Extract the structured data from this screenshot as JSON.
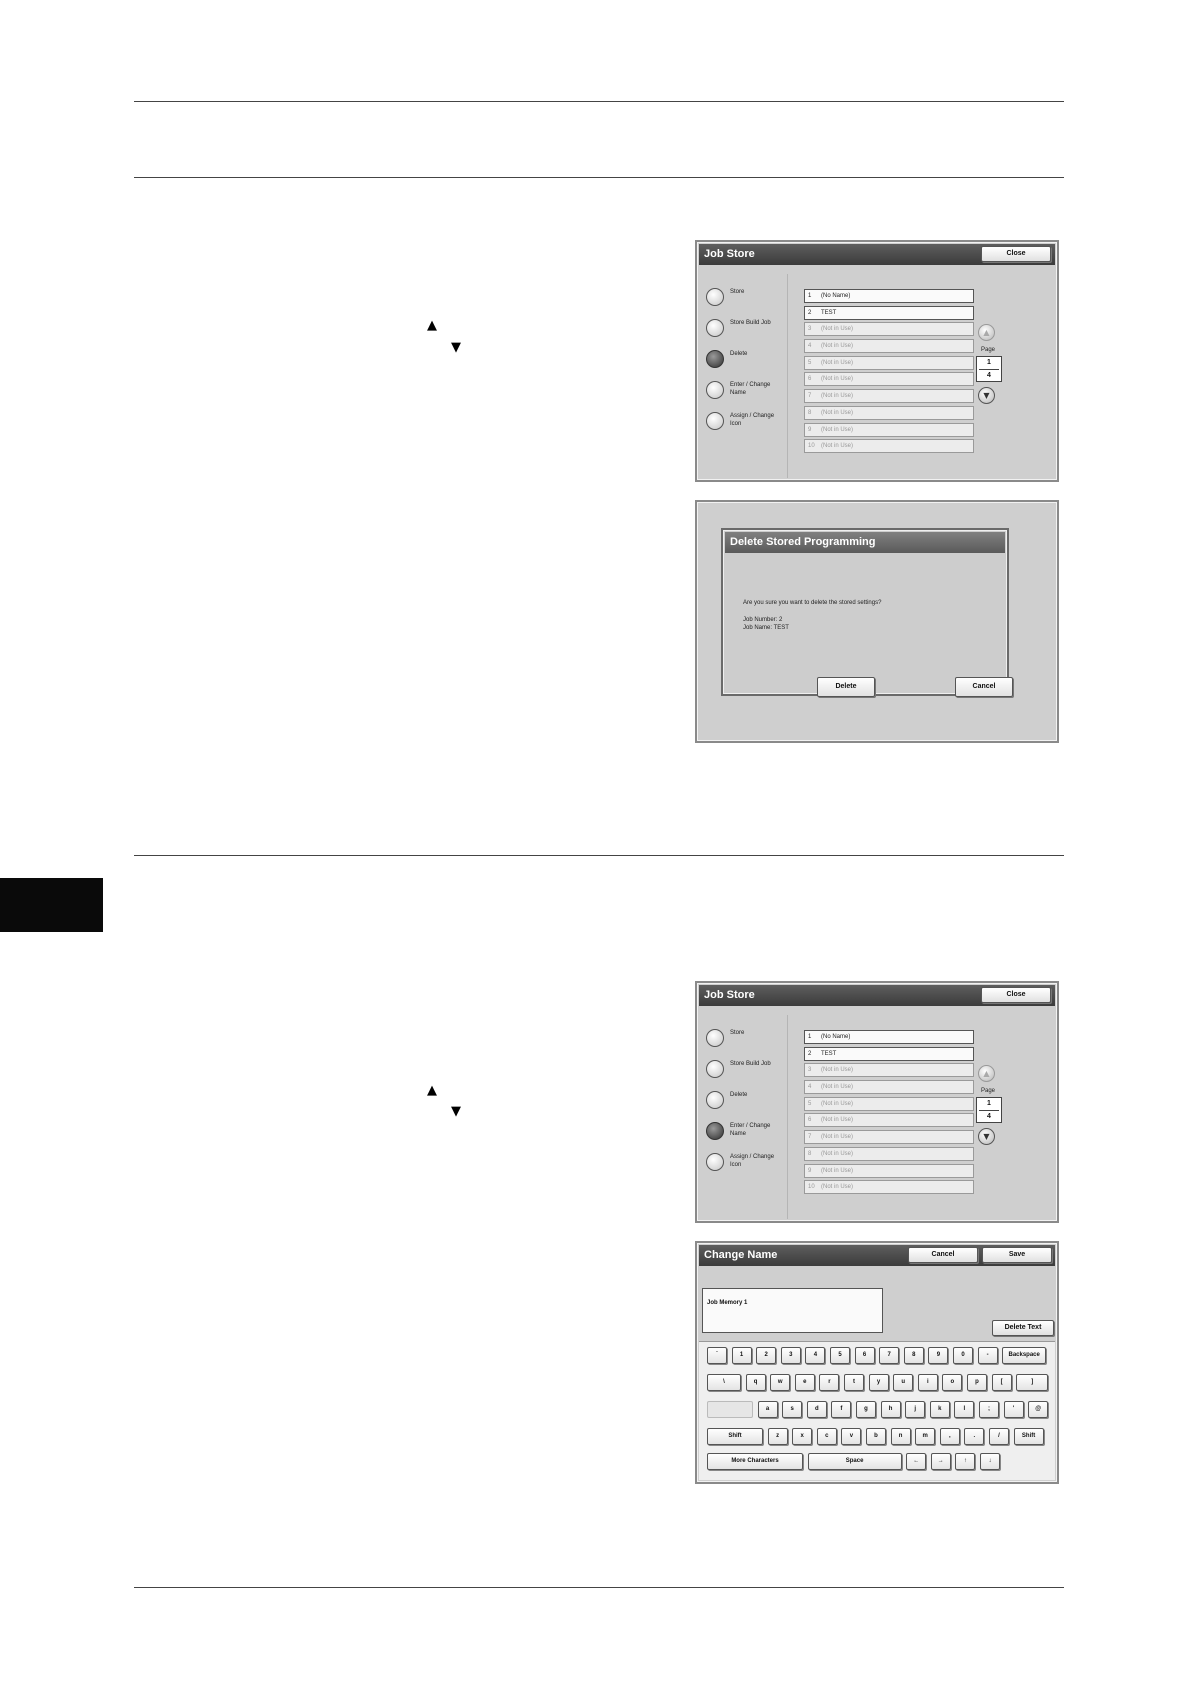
{
  "page": {
    "tab_down_symbol": "▼",
    "tab_up_symbol": "▲"
  },
  "job_store": {
    "title": "Job Store",
    "close_label": "Close",
    "options": [
      {
        "label": "Store"
      },
      {
        "label": "Store Build Job"
      },
      {
        "label": "Delete"
      },
      {
        "label": "Enter / Change Name"
      },
      {
        "label": "Assign / Change Icon"
      }
    ],
    "items": [
      {
        "num": "1",
        "name": "(No Name)",
        "used": true
      },
      {
        "num": "2",
        "name": "TEST",
        "used": true
      },
      {
        "num": "3",
        "name": "(Not in Use)",
        "used": false
      },
      {
        "num": "4",
        "name": "(Not in Use)",
        "used": false
      },
      {
        "num": "5",
        "name": "(Not in Use)",
        "used": false
      },
      {
        "num": "6",
        "name": "(Not in Use)",
        "used": false
      },
      {
        "num": "7",
        "name": "(Not in Use)",
        "used": false
      },
      {
        "num": "8",
        "name": "(Not in Use)",
        "used": false
      },
      {
        "num": "9",
        "name": "(Not in Use)",
        "used": false
      },
      {
        "num": "10",
        "name": "(Not in Use)",
        "used": false
      }
    ],
    "page_label": "Page",
    "page_current": "1",
    "page_total": "4"
  },
  "panel1": {
    "selected_option": "Delete"
  },
  "panel3": {
    "selected_option": "Enter / Change Name"
  },
  "delete_dialog": {
    "title": "Delete Stored Programming",
    "message": "Are you sure you want to delete the stored settings?",
    "job_number": "Job Number: 2",
    "job_name": "Job Name: TEST",
    "delete_label": "Delete",
    "cancel_label": "Cancel"
  },
  "change_name": {
    "title": "Change Name",
    "cancel_label": "Cancel",
    "save_label": "Save",
    "field_value": "Job Memory 1",
    "delete_text_label": "Delete Text",
    "rows": [
      [
        "`",
        "1",
        "2",
        "3",
        "4",
        "5",
        "6",
        "7",
        "8",
        "9",
        "0",
        "-",
        "Backspace"
      ],
      [
        "\\",
        "q",
        "w",
        "e",
        "r",
        "t",
        "y",
        "u",
        "i",
        "o",
        "p",
        "[",
        "]"
      ],
      [
        "",
        "a",
        "s",
        "d",
        "f",
        "g",
        "h",
        "j",
        "k",
        "l",
        ";",
        "'",
        "@"
      ],
      [
        "Shift",
        "z",
        "x",
        "c",
        "v",
        "b",
        "n",
        "m",
        ",",
        ".",
        "/",
        "Shift"
      ],
      [
        "More Characters",
        "Space",
        "←",
        "→",
        "↑",
        "↓"
      ]
    ]
  }
}
